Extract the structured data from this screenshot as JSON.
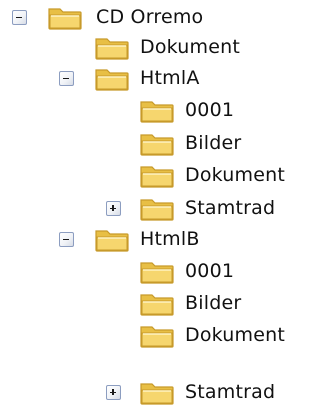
{
  "tree": {
    "items": [
      {
        "label": "CD Orremo",
        "expander": "minus",
        "icon": "folder-icon"
      },
      {
        "label": "Dokument",
        "expander": "",
        "icon": "folder-icon"
      },
      {
        "label": "HtmlA",
        "expander": "minus",
        "icon": "folder-icon"
      },
      {
        "label": "0001",
        "expander": "",
        "icon": "folder-icon"
      },
      {
        "label": "Bilder",
        "expander": "",
        "icon": "folder-icon"
      },
      {
        "label": "Dokument",
        "expander": "",
        "icon": "folder-icon"
      },
      {
        "label": "Stamtrad",
        "expander": "plus",
        "icon": "folder-icon"
      },
      {
        "label": "HtmlB",
        "expander": "minus",
        "icon": "folder-icon"
      },
      {
        "label": "0001",
        "expander": "",
        "icon": "folder-icon"
      },
      {
        "label": "Bilder",
        "expander": "",
        "icon": "folder-icon"
      },
      {
        "label": "Dokument",
        "expander": "",
        "icon": "folder-icon"
      },
      {
        "label": "Stamtrad",
        "expander": "plus",
        "icon": "folder-icon"
      }
    ]
  },
  "colors": {
    "folder_body": "#f2d063",
    "folder_outline": "#c79a2a",
    "folder_highlight": "#fff3c2",
    "expander_border": "#8c9dc0"
  }
}
